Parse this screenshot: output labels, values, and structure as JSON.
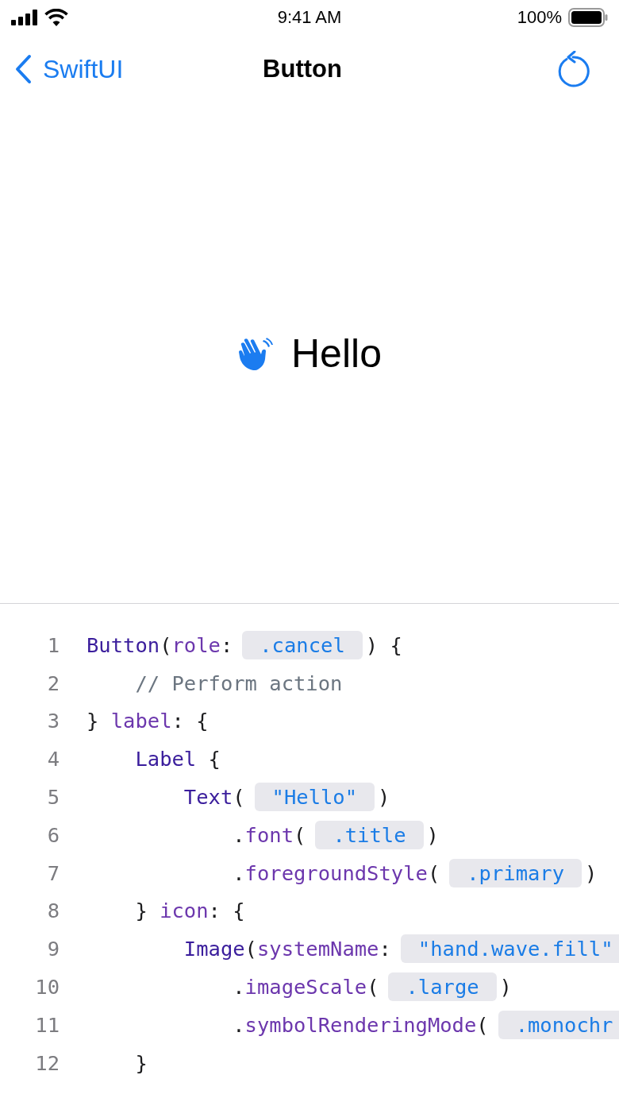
{
  "status_bar": {
    "time": "9:41 AM",
    "battery": "100%"
  },
  "nav": {
    "back": "SwiftUI",
    "title": "Button"
  },
  "preview": {
    "label": "Hello"
  },
  "code": {
    "lines": [
      {
        "number": "1",
        "segments": [
          {
            "kind": "code",
            "parts": [
              {
                "kind": "type",
                "text": "Button"
              },
              {
                "kind": "plain",
                "text": "("
              },
              {
                "kind": "member",
                "text": "role"
              },
              {
                "kind": "plain",
                "text": ":"
              }
            ]
          },
          {
            "kind": "value",
            "text": ".cancel"
          },
          {
            "kind": "code",
            "parts": [
              {
                "kind": "plain",
                "text": ") {"
              }
            ]
          }
        ]
      },
      {
        "number": "2",
        "segments": [
          {
            "kind": "code",
            "parts": [
              {
                "kind": "comment",
                "text": "    // Perform action"
              }
            ]
          }
        ]
      },
      {
        "number": "3",
        "segments": [
          {
            "kind": "code",
            "parts": [
              {
                "kind": "plain",
                "text": "} "
              },
              {
                "kind": "member",
                "text": "label"
              },
              {
                "kind": "plain",
                "text": ": {"
              }
            ]
          }
        ]
      },
      {
        "number": "4",
        "segments": [
          {
            "kind": "code",
            "parts": [
              {
                "kind": "type",
                "text": "    Label"
              },
              {
                "kind": "plain",
                "text": " {"
              }
            ]
          }
        ]
      },
      {
        "number": "5",
        "segments": [
          {
            "kind": "code",
            "parts": [
              {
                "kind": "type",
                "text": "        Text"
              },
              {
                "kind": "plain",
                "text": "("
              }
            ]
          },
          {
            "kind": "value",
            "text": "\"Hello\""
          },
          {
            "kind": "code",
            "parts": [
              {
                "kind": "plain",
                "text": ")"
              }
            ]
          }
        ]
      },
      {
        "number": "6",
        "segments": [
          {
            "kind": "code",
            "parts": [
              {
                "kind": "plain",
                "text": "            ."
              },
              {
                "kind": "member",
                "text": "font"
              },
              {
                "kind": "plain",
                "text": "("
              }
            ]
          },
          {
            "kind": "value",
            "text": ".title"
          },
          {
            "kind": "code",
            "parts": [
              {
                "kind": "plain",
                "text": ")"
              }
            ]
          }
        ]
      },
      {
        "number": "7",
        "segments": [
          {
            "kind": "code",
            "parts": [
              {
                "kind": "plain",
                "text": "            ."
              },
              {
                "kind": "member",
                "text": "foregroundStyle"
              },
              {
                "kind": "plain",
                "text": "("
              }
            ]
          },
          {
            "kind": "value",
            "text": ".primary"
          },
          {
            "kind": "code",
            "parts": [
              {
                "kind": "plain",
                "text": ")"
              }
            ]
          }
        ]
      },
      {
        "number": "8",
        "segments": [
          {
            "kind": "code",
            "parts": [
              {
                "kind": "plain",
                "text": "    } "
              },
              {
                "kind": "member",
                "text": "icon"
              },
              {
                "kind": "plain",
                "text": ": {"
              }
            ]
          }
        ]
      },
      {
        "number": "9",
        "segments": [
          {
            "kind": "code",
            "parts": [
              {
                "kind": "type",
                "text": "        Image"
              },
              {
                "kind": "plain",
                "text": "("
              },
              {
                "kind": "member",
                "text": "systemName"
              },
              {
                "kind": "plain",
                "text": ":"
              }
            ]
          },
          {
            "kind": "value",
            "text": "\"hand.wave.fill\""
          }
        ]
      },
      {
        "number": "10",
        "segments": [
          {
            "kind": "code",
            "parts": [
              {
                "kind": "plain",
                "text": "            ."
              },
              {
                "kind": "member",
                "text": "imageScale"
              },
              {
                "kind": "plain",
                "text": "("
              }
            ]
          },
          {
            "kind": "value",
            "text": ".large"
          },
          {
            "kind": "code",
            "parts": [
              {
                "kind": "plain",
                "text": ")"
              }
            ]
          }
        ]
      },
      {
        "number": "11",
        "segments": [
          {
            "kind": "code",
            "parts": [
              {
                "kind": "plain",
                "text": "            ."
              },
              {
                "kind": "member",
                "text": "symbolRenderingMode"
              },
              {
                "kind": "plain",
                "text": "("
              }
            ]
          },
          {
            "kind": "value",
            "text": ".monochr"
          }
        ]
      },
      {
        "number": "12",
        "segments": [
          {
            "kind": "code",
            "parts": [
              {
                "kind": "plain",
                "text": "    }"
              }
            ]
          }
        ]
      }
    ]
  }
}
